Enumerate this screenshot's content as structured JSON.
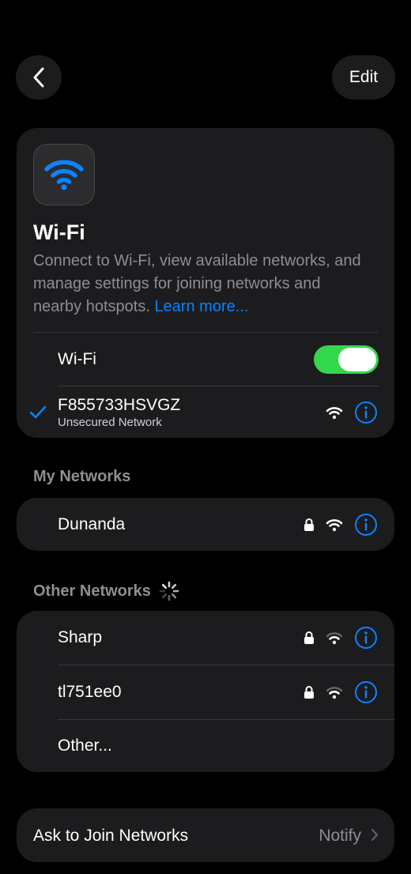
{
  "nav": {
    "back_icon": "chevron-left-icon",
    "edit_label": "Edit"
  },
  "hero": {
    "icon": "wifi-icon",
    "title": "Wi-Fi",
    "description": "Connect to Wi-Fi, view available networks, and manage settings for joining networks and nearby hotspots.",
    "learn_more": "Learn more..."
  },
  "wifi_toggle": {
    "label": "Wi-Fi",
    "on": true
  },
  "connected": {
    "name": "F855733HSVGZ",
    "status": "Unsecured Network",
    "secured": false
  },
  "my_networks": {
    "header": "My Networks",
    "items": [
      {
        "name": "Dunanda",
        "secured": true
      }
    ]
  },
  "other_networks": {
    "header": "Other Networks",
    "items": [
      {
        "name": "Sharp",
        "secured": true
      },
      {
        "name": "tl751ee0",
        "secured": true
      }
    ],
    "other_label": "Other..."
  },
  "ask_to_join": {
    "label": "Ask to Join Networks",
    "value": "Notify"
  },
  "colors": {
    "accent": "#0a84ff",
    "toggle_on": "#32d74b",
    "card": "#1c1c1e",
    "background": "#000000"
  }
}
